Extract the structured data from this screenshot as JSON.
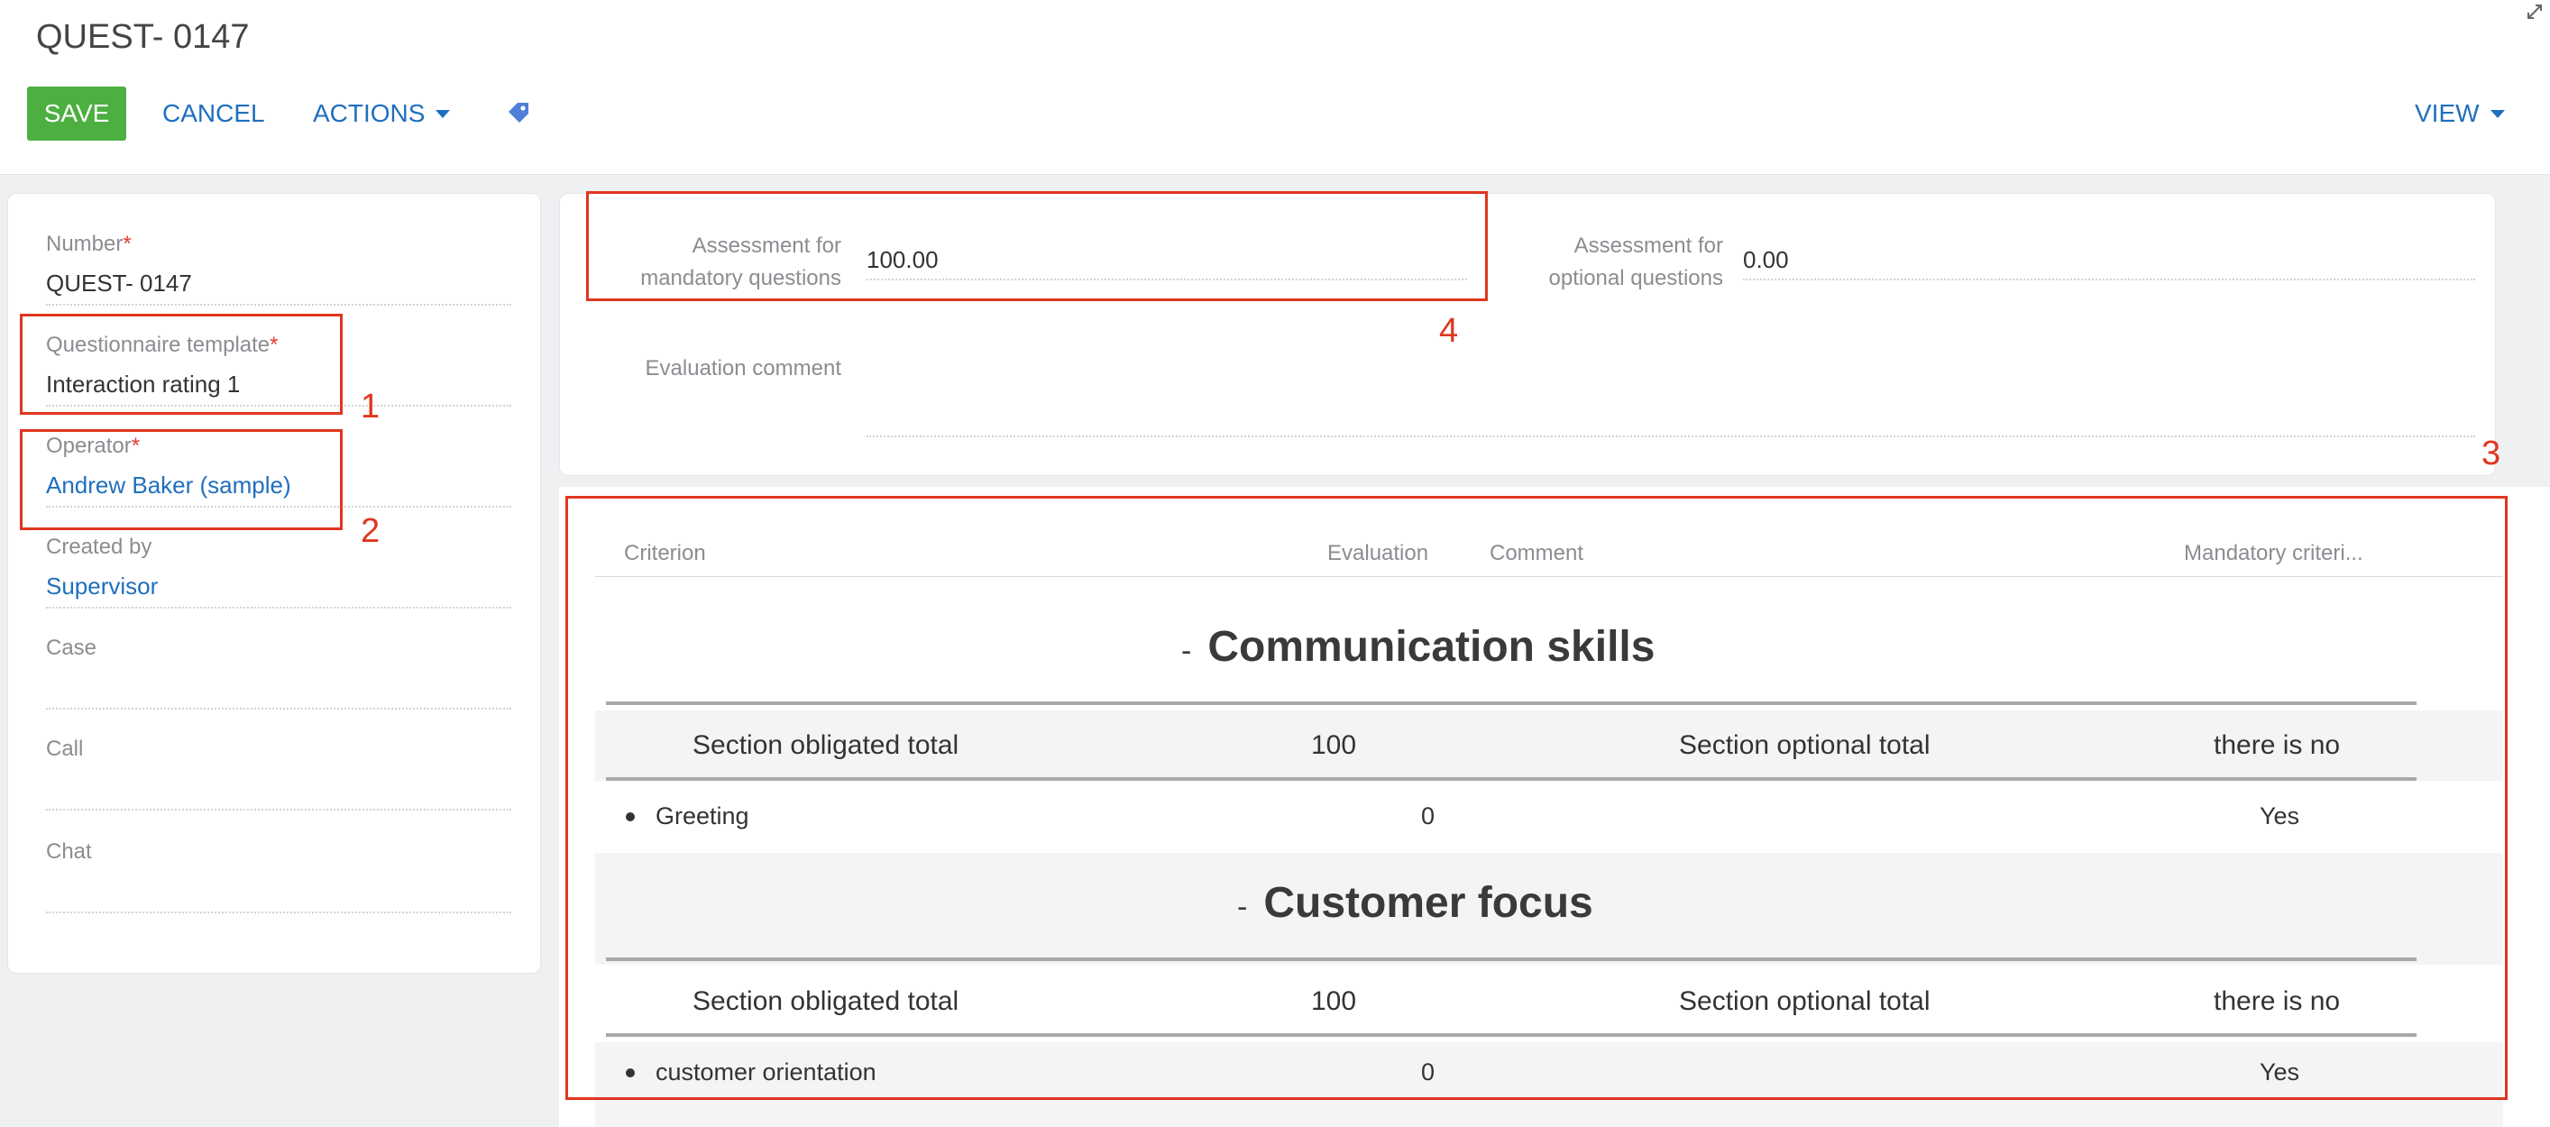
{
  "header": {
    "title": "QUEST- 0147",
    "save_label": "SAVE",
    "cancel_label": "CANCEL",
    "actions_label": "ACTIONS",
    "view_label": "VIEW"
  },
  "left_panel": {
    "number": {
      "label": "Number",
      "value": "QUEST- 0147",
      "required": true
    },
    "template": {
      "label": "Questionnaire template",
      "value": "Interaction rating 1",
      "required": true
    },
    "operator": {
      "label": "Operator",
      "value": "Andrew Baker (sample)",
      "required": true
    },
    "created_by": {
      "label": "Created by",
      "value": "Supervisor"
    },
    "case": {
      "label": "Case",
      "value": ""
    },
    "call": {
      "label": "Call",
      "value": ""
    },
    "chat": {
      "label": "Chat",
      "value": ""
    }
  },
  "assessment": {
    "mandatory_label": "Assessment for mandatory questions",
    "mandatory_label_line1": "Assessment for",
    "mandatory_label_line2": "mandatory questions",
    "mandatory_value": "100.00",
    "optional_label": "Assessment for optional questions",
    "optional_label_line1": "Assessment for",
    "optional_label_line2": "optional questions",
    "optional_value": "0.00",
    "comment_label": "Evaluation comment",
    "comment_value": ""
  },
  "grid": {
    "columns": [
      "Criterion",
      "Evaluation",
      "Comment",
      "Mandatory criteri..."
    ],
    "sections": [
      {
        "title": "Communication skills",
        "obligated_label": "Section obligated total",
        "obligated_value": "100",
        "optional_label": "Section optional total",
        "optional_value": "there is no",
        "items": [
          {
            "criterion": "Greeting",
            "evaluation": "0",
            "mandatory": "Yes"
          }
        ]
      },
      {
        "title": "Customer focus",
        "obligated_label": "Section obligated total",
        "obligated_value": "100",
        "optional_label": "Section optional total",
        "optional_value": "there is no",
        "items": [
          {
            "criterion": "customer orientation",
            "evaluation": "0",
            "mandatory": "Yes"
          }
        ]
      }
    ]
  },
  "annotations": [
    "1",
    "2",
    "3",
    "4"
  ],
  "colors": {
    "save_button": "#4caf40",
    "link": "#1f6fbf",
    "annotation": "#e0361f",
    "required_marker": "#e03a2f"
  },
  "icons": [
    "caret-down-icon",
    "tag-icon",
    "expand-icon",
    "minus-icon",
    "bullet-icon"
  ]
}
